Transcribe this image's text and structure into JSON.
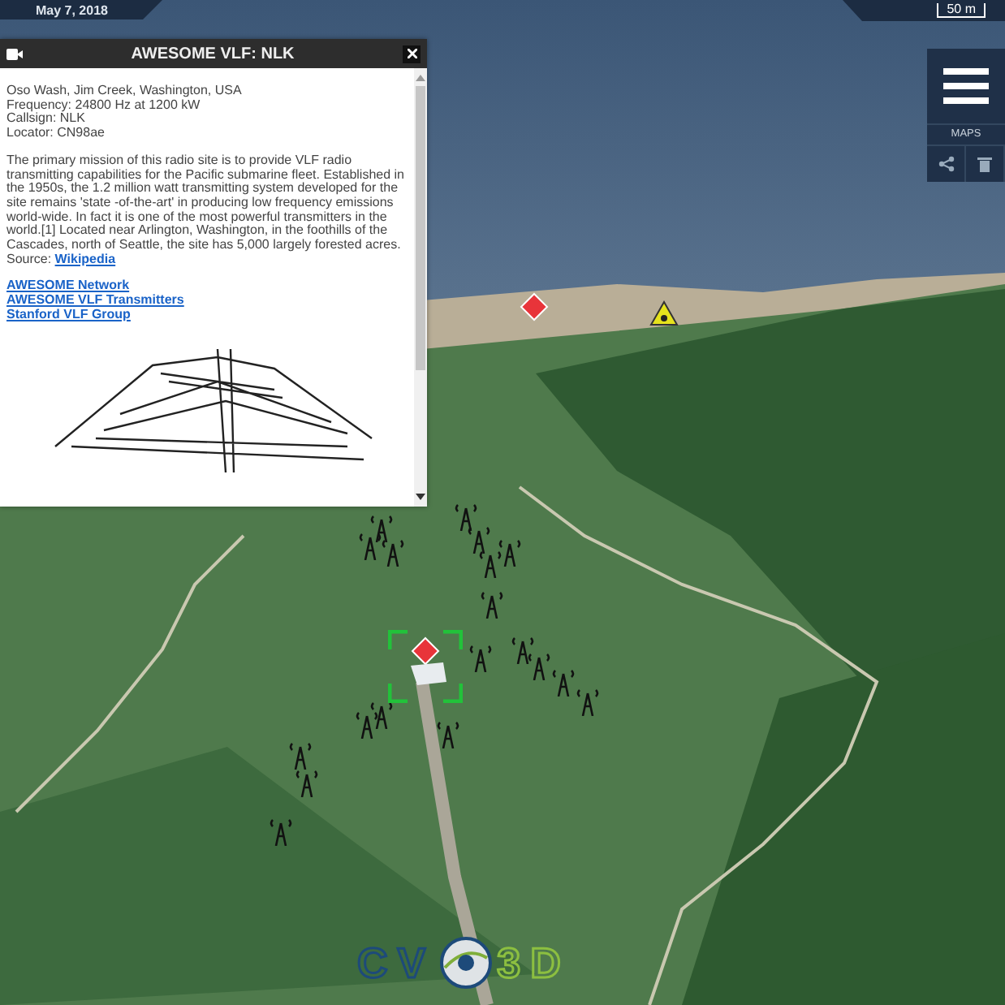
{
  "top_bar": {
    "date": "May 7, 2018",
    "scale": "50 m"
  },
  "side_menu": {
    "label": "MAPS"
  },
  "popup": {
    "title": "AWESOME VLF: NLK",
    "details": [
      "Oso Wash, Jim Creek, Washington, USA",
      "Frequency: 24800 Hz at 1200 kW",
      "Callsign: NLK",
      "Locator: CN98ae"
    ],
    "description": "The primary mission of this radio site is to provide VLF radio transmitting capabilities for the Pacific submarine fleet. Established in the 1950s, the 1.2 million watt transmitting system developed for the site remains 'state -of-the-art' in producing low frequency emissions world-wide. In fact it is one of the most powerful transmitters in the world.[1] Located near Arlington, Washington, in the foothills of the Cascades, north of Seattle, the site has 5,000 largely forested acres. Source: ",
    "source_link": "Wikipedia",
    "links": [
      "AWESOME Network",
      "AWESOME VLF Transmitters",
      "Stanford VLF Group"
    ]
  },
  "logo": {
    "left": "CV",
    "right": "3D"
  }
}
